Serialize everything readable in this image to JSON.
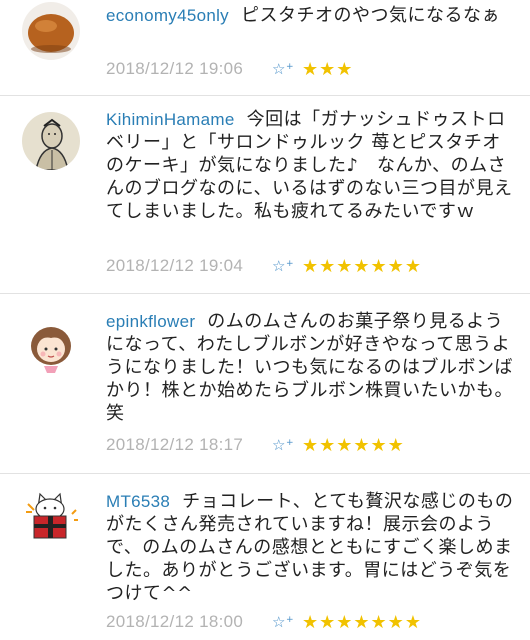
{
  "comments": [
    {
      "user": "economy45only",
      "text": "ピスタチオのやつ気になるなぁ",
      "timestamp": "2018/12/12 19:06",
      "add_star_icon": "star-plus-icon",
      "stars": "★★★",
      "avatar_icon": "bread-bun-avatar"
    },
    {
      "user": "KihiminHamame",
      "text": "今回は「ガナッシュドゥストロベリー」と「サロンドゥルック 苺とピスタチオのケーキ」が気になりました♪　なんか、のムさんのブログなのに、いるはずのない三つ目が見えてしまいました。私も疲れてるみたいですｗ",
      "timestamp": "2018/12/12 19:04",
      "add_star_icon": "star-plus-icon",
      "stars": "★★★★★★★",
      "avatar_icon": "ink-portrait-avatar"
    },
    {
      "user": "epinkflower",
      "text": "のムのムさんのお菓子祭り見るようになって、わたしブルボンが好きやなって思うようになりました！いつも気になるのはブルボンばかり！株とか始めたらブルボン株買いたいかも。笑",
      "timestamp": "2018/12/12 18:17",
      "add_star_icon": "star-plus-icon",
      "stars": "★★★★★★",
      "avatar_icon": "girl-face-avatar"
    },
    {
      "user": "MT6538",
      "text": "チョコレート、とても贅沢な感じのものがたくさん発売されていますね！展示会のようで、のムのムさんの感想とともにすごく楽しめました。ありがとうございます。胃にはどうぞ気をつけて^^",
      "timestamp": "2018/12/12 18:00",
      "add_star_icon": "star-plus-icon",
      "stars": "★★★★★★★",
      "avatar_icon": "cat-gift-box-avatar"
    }
  ],
  "colors": {
    "username": "#2a7eb5",
    "timestamp": "#b3b3b3",
    "star": "#f1c200",
    "add_star": "#4a90c8",
    "divider": "#e2e2e2"
  }
}
